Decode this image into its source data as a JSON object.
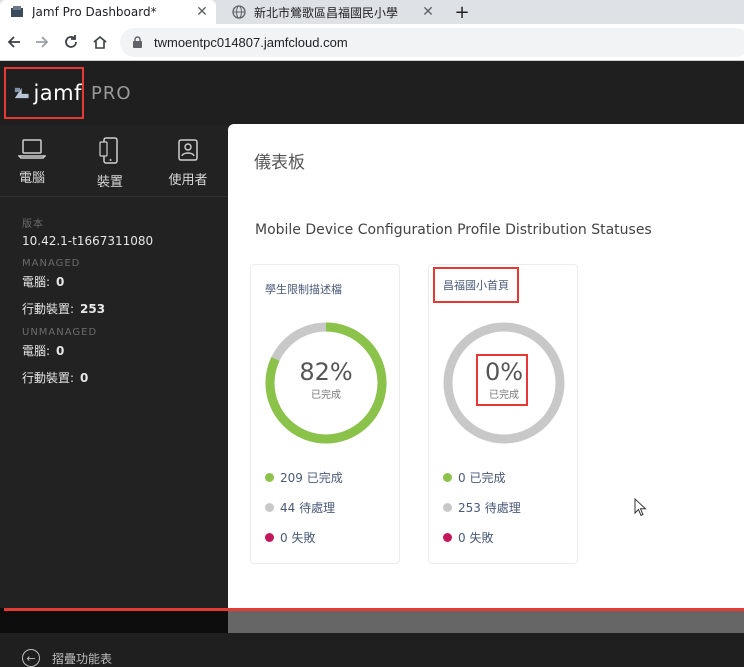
{
  "browser": {
    "tabs": [
      {
        "title": "Jamf Pro Dashboard*",
        "close": "✕",
        "active": true
      },
      {
        "title": "新北市鶯歌區昌福國民小學",
        "close": "✕",
        "active": false
      }
    ],
    "new_tab": "+",
    "url": "twmoentpc014807.jamfcloud.com"
  },
  "app": {
    "logo_text": "jamf",
    "pro_label": "PRO",
    "nav_tabs": [
      {
        "label": "電腦",
        "icon": "laptop-icon"
      },
      {
        "label": "裝置",
        "icon": "mobile-device-icon"
      },
      {
        "label": "使用者",
        "icon": "user-badge-icon"
      }
    ],
    "sidebar": {
      "version_label": "版本",
      "version_value": "10.42.1-t1667311080",
      "managed_label": "MANAGED",
      "managed_computers_label": "電腦:",
      "managed_computers_value": "0",
      "managed_devices_label": "行動裝置:",
      "managed_devices_value": "253",
      "unmanaged_label": "UNMANAGED",
      "unmanaged_computers_label": "電腦:",
      "unmanaged_computers_value": "0",
      "unmanaged_devices_label": "行動裝置:",
      "unmanaged_devices_value": "0",
      "collapse_label": "摺疊功能表"
    },
    "main": {
      "page_title": "儀表板",
      "section_title": "Mobile Device Configuration Profile Distribution Statuses",
      "cards": [
        {
          "title": "學生限制描述檔",
          "percent": "82%",
          "percent_value": 82,
          "percent_sub": "已完成",
          "completed": "209 已完成",
          "pending": "44 待處理",
          "failed": "0 失敗"
        },
        {
          "title": "昌福國小首頁",
          "percent": "0%",
          "percent_value": 0,
          "percent_sub": "已完成",
          "completed": "0 已完成",
          "pending": "253 待處理",
          "failed": "0 失敗"
        }
      ]
    }
  },
  "colors": {
    "complete": "#8bc34a",
    "pending": "#c8c8c8",
    "failed": "#c2185b",
    "highlight": "#e53935"
  }
}
